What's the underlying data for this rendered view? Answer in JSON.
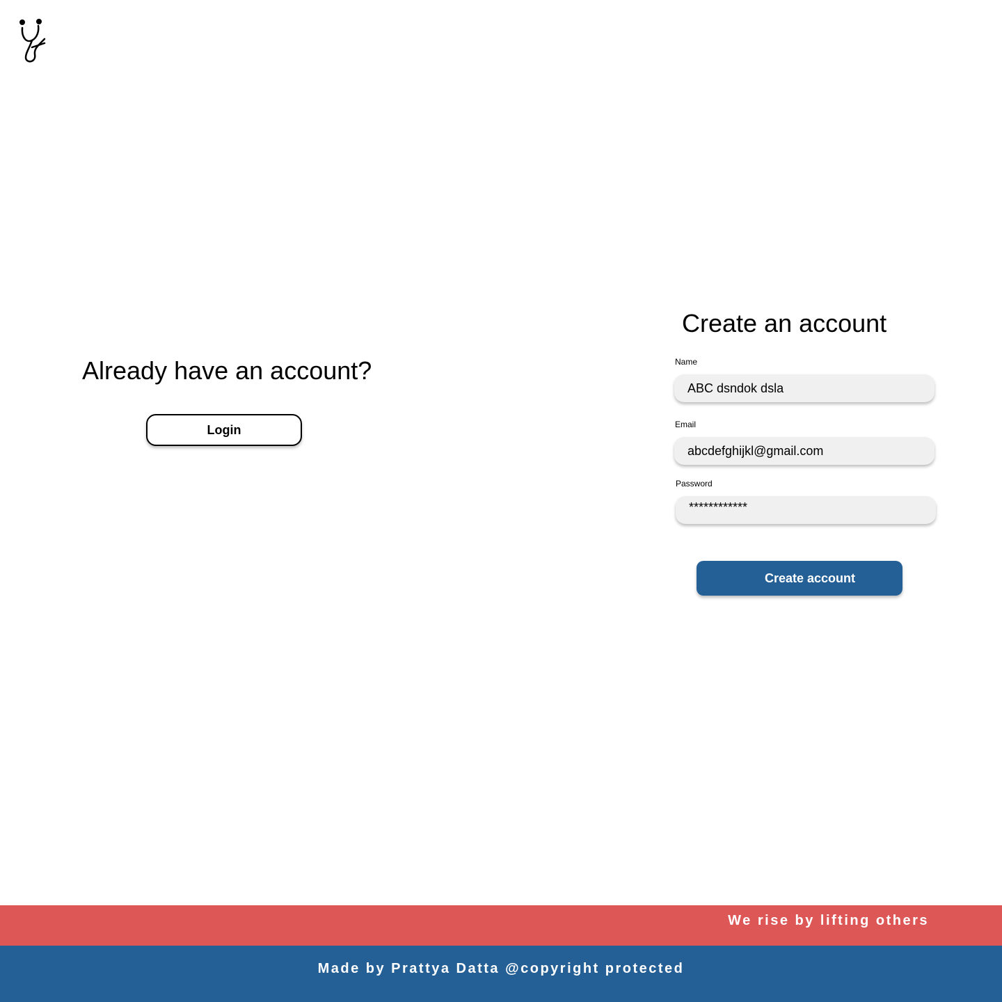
{
  "logo": {
    "icon": "stethoscope-logo-icon"
  },
  "login_section": {
    "heading": "Already have an account?",
    "button_label": "Login"
  },
  "signup_section": {
    "heading": "Create an account",
    "name_label": "Name",
    "name_value": "ABC dsndok dsla",
    "email_label": "Email",
    "email_value": "abcdefghijkl@gmail.com",
    "password_label": "Password",
    "password_value": "************",
    "submit_label": "Create account"
  },
  "tagline": "We rise by lifting others",
  "footer": "Made by Prattya Datta @copyright protected",
  "colors": {
    "primary_blue": "#245f96",
    "tagline_red": "#de5757",
    "field_bg": "#f0f0f0"
  }
}
